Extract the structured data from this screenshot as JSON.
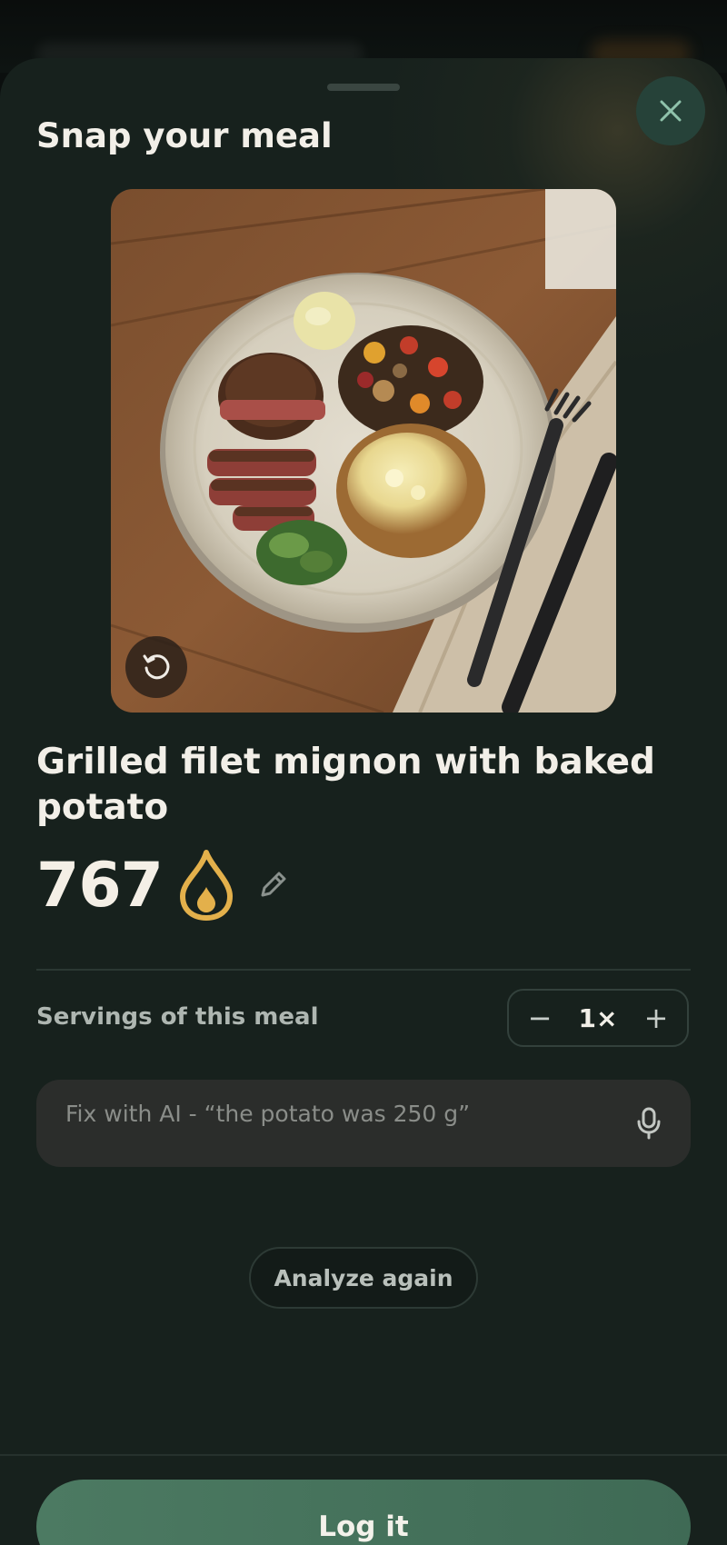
{
  "sheet": {
    "title": "Snap your meal",
    "close_icon": "close-icon"
  },
  "photo": {
    "retake_icon": "retake-icon"
  },
  "meal": {
    "name": "Grilled filet mignon with baked potato",
    "calories": "767",
    "calorie_icon": "flame-icon",
    "edit_icon": "pencil-icon",
    "accent_color": "#e3b04b"
  },
  "servings": {
    "label": "Servings of this meal",
    "value": "1×",
    "decrement_label": "−",
    "increment_label": "+"
  },
  "fix": {
    "placeholder": "Fix with AI - “the potato was 250 g”",
    "mic_icon": "microphone-icon"
  },
  "actions": {
    "analyze_label": "Analyze again",
    "log_label": "Log it",
    "primary_color": "#4a785f"
  }
}
